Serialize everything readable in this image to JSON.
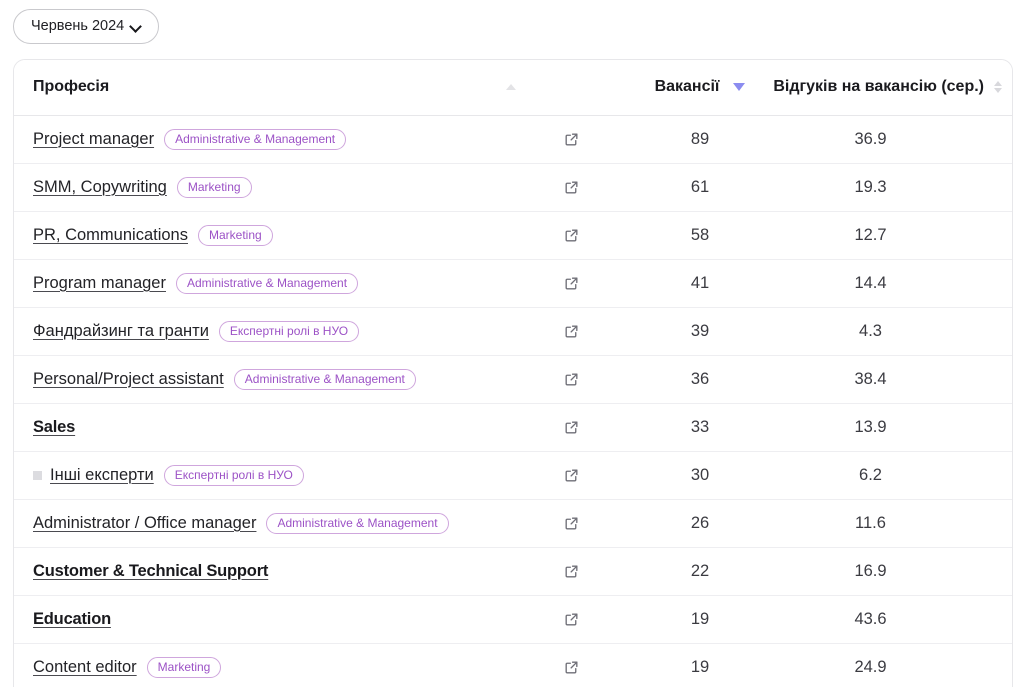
{
  "toolbar": {
    "date_filter_label": "Червень 2024",
    "chevron_icon": "chevron-down-icon"
  },
  "table": {
    "columns": {
      "profession": "Професія",
      "link": "",
      "vacancies": "Вакансії",
      "responses": "Відгуків на вакансію (сер.)"
    },
    "sort": {
      "profession_state": "none",
      "vacancies_state": "desc",
      "responses_state": "none",
      "active_color": "#8b8cf0",
      "inactive_color": "#d8d8dc"
    },
    "badge_colors": {
      "text": "#9c52c6",
      "border": "#cfa6dd"
    },
    "rows": [
      {
        "profession": "Project manager",
        "badge": "Administrative & Management",
        "bold": false,
        "tofu": false,
        "link_icon": "external-link-icon",
        "vacancies": "89",
        "responses": "36.9"
      },
      {
        "profession": "SMM, Copywriting",
        "badge": "Marketing",
        "bold": false,
        "tofu": false,
        "link_icon": "external-link-icon",
        "vacancies": "61",
        "responses": "19.3"
      },
      {
        "profession": "PR, Communications",
        "badge": "Marketing",
        "bold": false,
        "tofu": false,
        "link_icon": "external-link-icon",
        "vacancies": "58",
        "responses": "12.7"
      },
      {
        "profession": "Program manager",
        "badge": "Administrative & Management",
        "bold": false,
        "tofu": false,
        "link_icon": "external-link-icon",
        "vacancies": "41",
        "responses": "14.4"
      },
      {
        "profession": "Фандрайзинг та гранти",
        "badge": "Експертні ролі в НУО",
        "bold": false,
        "tofu": false,
        "link_icon": "external-link-icon",
        "vacancies": "39",
        "responses": "4.3"
      },
      {
        "profession": "Personal/Project assistant",
        "badge": "Administrative & Management",
        "bold": false,
        "tofu": false,
        "link_icon": "external-link-icon",
        "vacancies": "36",
        "responses": "38.4"
      },
      {
        "profession": "Sales",
        "badge": "",
        "bold": true,
        "tofu": false,
        "link_icon": "external-link-icon",
        "vacancies": "33",
        "responses": "13.9"
      },
      {
        "profession": "Інші експерти",
        "badge": "Експертні ролі в НУО",
        "bold": false,
        "tofu": true,
        "link_icon": "external-link-icon",
        "vacancies": "30",
        "responses": "6.2"
      },
      {
        "profession": "Administrator / Office manager",
        "badge": "Administrative & Management",
        "bold": false,
        "tofu": false,
        "link_icon": "external-link-icon",
        "vacancies": "26",
        "responses": "11.6"
      },
      {
        "profession": "Customer & Technical Support",
        "badge": "",
        "bold": true,
        "tofu": false,
        "link_icon": "external-link-icon",
        "vacancies": "22",
        "responses": "16.9"
      },
      {
        "profession": "Education",
        "badge": "",
        "bold": true,
        "tofu": false,
        "link_icon": "external-link-icon",
        "vacancies": "19",
        "responses": "43.6"
      },
      {
        "profession": "Content editor",
        "badge": "Marketing",
        "bold": false,
        "tofu": false,
        "link_icon": "external-link-icon",
        "vacancies": "19",
        "responses": "24.9"
      }
    ]
  }
}
